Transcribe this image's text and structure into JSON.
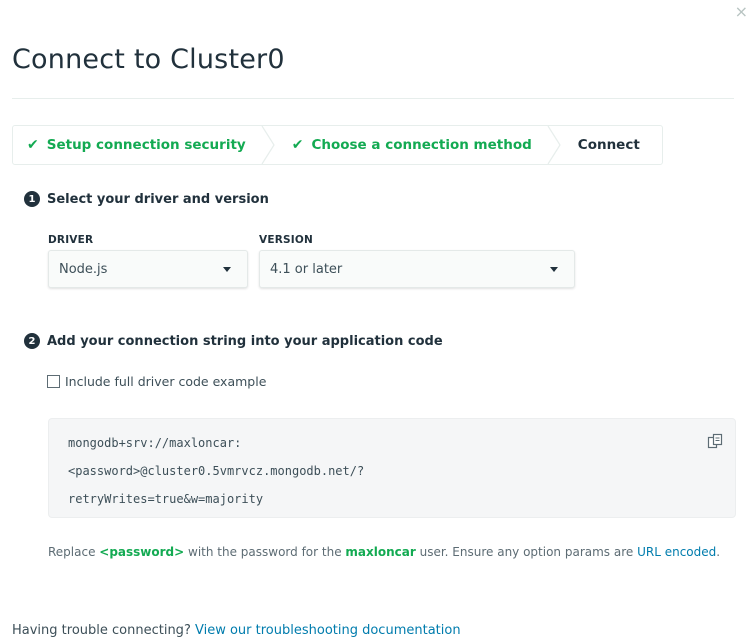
{
  "modal": {
    "title": "Connect to Cluster0",
    "close_glyph": "×"
  },
  "steps": [
    {
      "label": "Setup connection security",
      "state": "done",
      "icon": "check-icon"
    },
    {
      "label": "Choose a connection method",
      "state": "done",
      "icon": "check-icon"
    },
    {
      "label": "Connect",
      "state": "current"
    }
  ],
  "section1": {
    "number": "1",
    "title": "Select your driver and version",
    "driver_label": "DRIVER",
    "driver_value": "Node.js",
    "version_label": "VERSION",
    "version_value": "4.1 or later"
  },
  "section2": {
    "number": "2",
    "title": "Add your connection string into your application code",
    "checkbox_label": "Include full driver code example",
    "checkbox_checked": false,
    "code_lines": [
      "mongodb+srv://maxloncar:",
      "<password>@cluster0.5vmrvcz.mongodb.net/?",
      "retryWrites=true&w=majority"
    ],
    "copy_icon": "copy-icon"
  },
  "note": {
    "part1": "Replace ",
    "password": "<password>",
    "part2": " with the password for the ",
    "user": "maxloncar",
    "part3": " user. Ensure any option params are ",
    "link": "URL encoded",
    "part4": "."
  },
  "trouble": {
    "text": "Having trouble connecting? ",
    "link": "View our troubleshooting documentation"
  },
  "colors": {
    "green": "#13aa52",
    "link": "#007cad",
    "text": "#21313c"
  }
}
